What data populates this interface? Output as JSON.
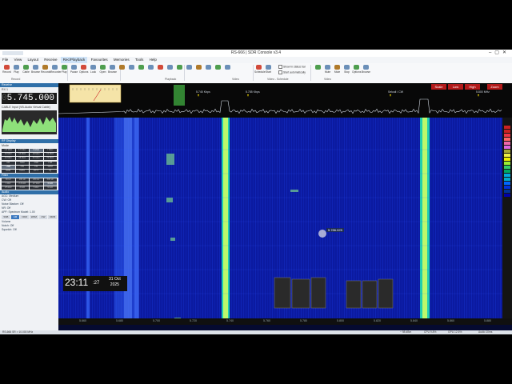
{
  "window": {
    "title": "RS-666 | SDR Console v3.4"
  },
  "menu": [
    "File",
    "View",
    "Layout",
    "Receive",
    "Rec/Playback",
    "Favourites",
    "Memories",
    "Tools",
    "Help"
  ],
  "ribbon": {
    "buttons": [
      "Record",
      "Play",
      "Cable",
      "Browse",
      "Records",
      "Recorder",
      "Play",
      "Pause",
      "Options",
      "Look",
      "Open",
      "Browse",
      "",
      "",
      "",
      "",
      "",
      "",
      "",
      "",
      "",
      "",
      "",
      "",
      "Schedule",
      "Start",
      "",
      "Mute",
      "Mute",
      "Stop",
      "Options",
      "Browse"
    ],
    "groups": [
      "Record",
      "Playback",
      "Video",
      "Video - Schedule",
      "Video"
    ],
    "checkboxes": [
      "Show in status bar",
      "Start automatically"
    ]
  },
  "receiver": {
    "section_title": "Receive",
    "rx_label": "RX 1",
    "frequency_dim": "0",
    "frequency": "5.745.000",
    "input_label": "CABLE Input (VB-Audio Virtual Cable)",
    "section2": "RF Display",
    "band_label": "Mode",
    "bands_a": [
      "1.8 MHz",
      "3.5 MHz",
      "5 MHz",
      "7 MHz",
      "10 MHz",
      "14 MHz",
      "18 MHz",
      "21 MHz",
      "24 MHz",
      "28 MHz",
      "50 MHz",
      "70 MHz"
    ],
    "bands_b": [
      "AM",
      "SAM",
      "DSB",
      "LSB",
      "USB",
      "CW",
      "FM",
      "WFM",
      "DRM",
      "DATA",
      "RTTY",
      "IQ"
    ],
    "section3": "Filter",
    "filters": [
      "50 Hz",
      "100 Hz",
      "200 Hz",
      "500 Hz",
      "1 kHz",
      "2.4 kHz",
      "2.7 kHz",
      "3 kHz",
      "3.5 kHz",
      "4 kHz",
      "6 kHz",
      "9 kHz"
    ],
    "section4": "Audio",
    "modes": [
      "SSB",
      "AM",
      "NFM",
      "WFM",
      "CW",
      "DRM"
    ],
    "list": [
      "AGC: Medium",
      "CW: Off",
      "Noise Blanker: Off",
      "NR: Off",
      "APF: Spectrum Model: 1.00",
      "Volume",
      "Notch: Off",
      "Squelch: Off"
    ]
  },
  "spectrum": {
    "controls": [
      "Scale",
      "Low",
      "High",
      "Zoom"
    ],
    "annotations": [
      "5.745 Kbps",
      "5.785 Kbps",
      "Selcall / CW",
      "5.800 MHz"
    ],
    "x_labels": [
      "5.660",
      "5.680",
      "5.700",
      "5.720",
      "5.740",
      "5.760",
      "5.780",
      "5.800",
      "5.820",
      "5.840",
      "5.860",
      "5.880"
    ],
    "cursor_label": "5.786.025"
  },
  "clock": {
    "time": "23:11",
    "seconds": ":27",
    "day": "31 Oct",
    "year": "2025"
  },
  "status": {
    "left": "RS-666 SR > 10.000 MHz",
    "right1": "~ 98 dBm",
    "right2": "CPU 9.8%",
    "right3": "GPU 12.6%",
    "right4": "Audio 10ms"
  },
  "colors": {
    "ribbon_blue": "#2f6fa8",
    "waterfall_bg": "#050a30",
    "signal_green": "#9ef65a",
    "control_red": "#b21a1a"
  }
}
